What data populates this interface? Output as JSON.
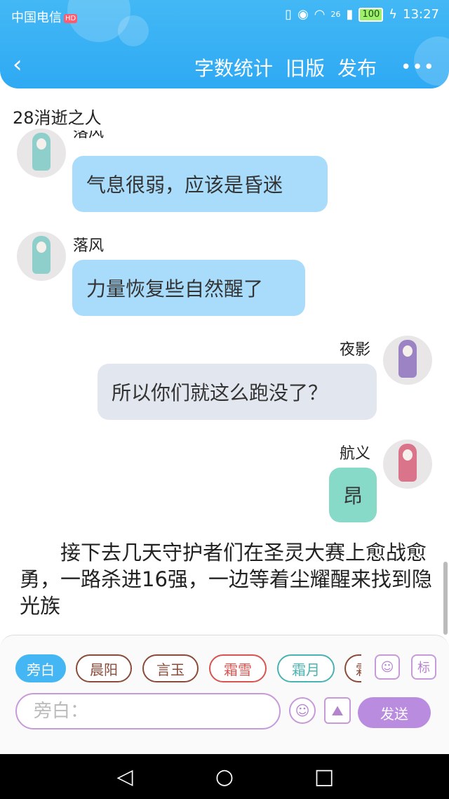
{
  "status_bar": {
    "carrier": "中国电信",
    "carrier_badge": "HD",
    "network": "26",
    "battery": "100",
    "time": "13:27"
  },
  "header": {
    "back_icon": "chevron-left-icon",
    "actions": [
      "字数统计",
      "旧版",
      "发布"
    ],
    "more_icon": "more-icon",
    "colors": {
      "accent": "#2ea9f3"
    }
  },
  "story": {
    "title": "28消逝之人"
  },
  "messages": [
    {
      "side": "left",
      "name": "落风",
      "text": "气息很弱，应该是昏迷",
      "style": "blue"
    },
    {
      "side": "left",
      "name": "落风",
      "text": "力量恢复些自然醒了",
      "style": "blue"
    },
    {
      "side": "right",
      "name": "夜影",
      "text": "所以你们就这么跑没了？",
      "style": "gray"
    },
    {
      "side": "right",
      "name": "航义",
      "text": "昂",
      "style": "teal"
    }
  ],
  "narration": "接下去几天守护者们在圣灵大赛上愈战愈勇，一路杀进16强，一边等着尘耀醒来找到隐光族",
  "composer": {
    "roles": [
      {
        "label": "旁白",
        "color": "#43b6f3",
        "active": true
      },
      {
        "label": "晨阳",
        "color": "#8a4b3a",
        "active": false
      },
      {
        "label": "言玉",
        "color": "#8a4b3a",
        "active": false
      },
      {
        "label": "霜雪",
        "color": "#d9534f",
        "active": false
      },
      {
        "label": "霜月",
        "color": "#4ab3b0",
        "active": false
      },
      {
        "label": "霜",
        "color": "#8a4b3a",
        "active": false
      }
    ],
    "role_tool_icon": "person-card-icon",
    "tag_button": "标",
    "placeholder": "旁白：",
    "emoji_icon": "smiley-icon",
    "image_icon": "image-icon",
    "send_label": "发送",
    "colors": {
      "purple": "#b98ce0"
    }
  },
  "system_nav": {
    "back": "back-triangle-icon",
    "home": "home-circle-icon",
    "recents": "recents-square-icon"
  }
}
